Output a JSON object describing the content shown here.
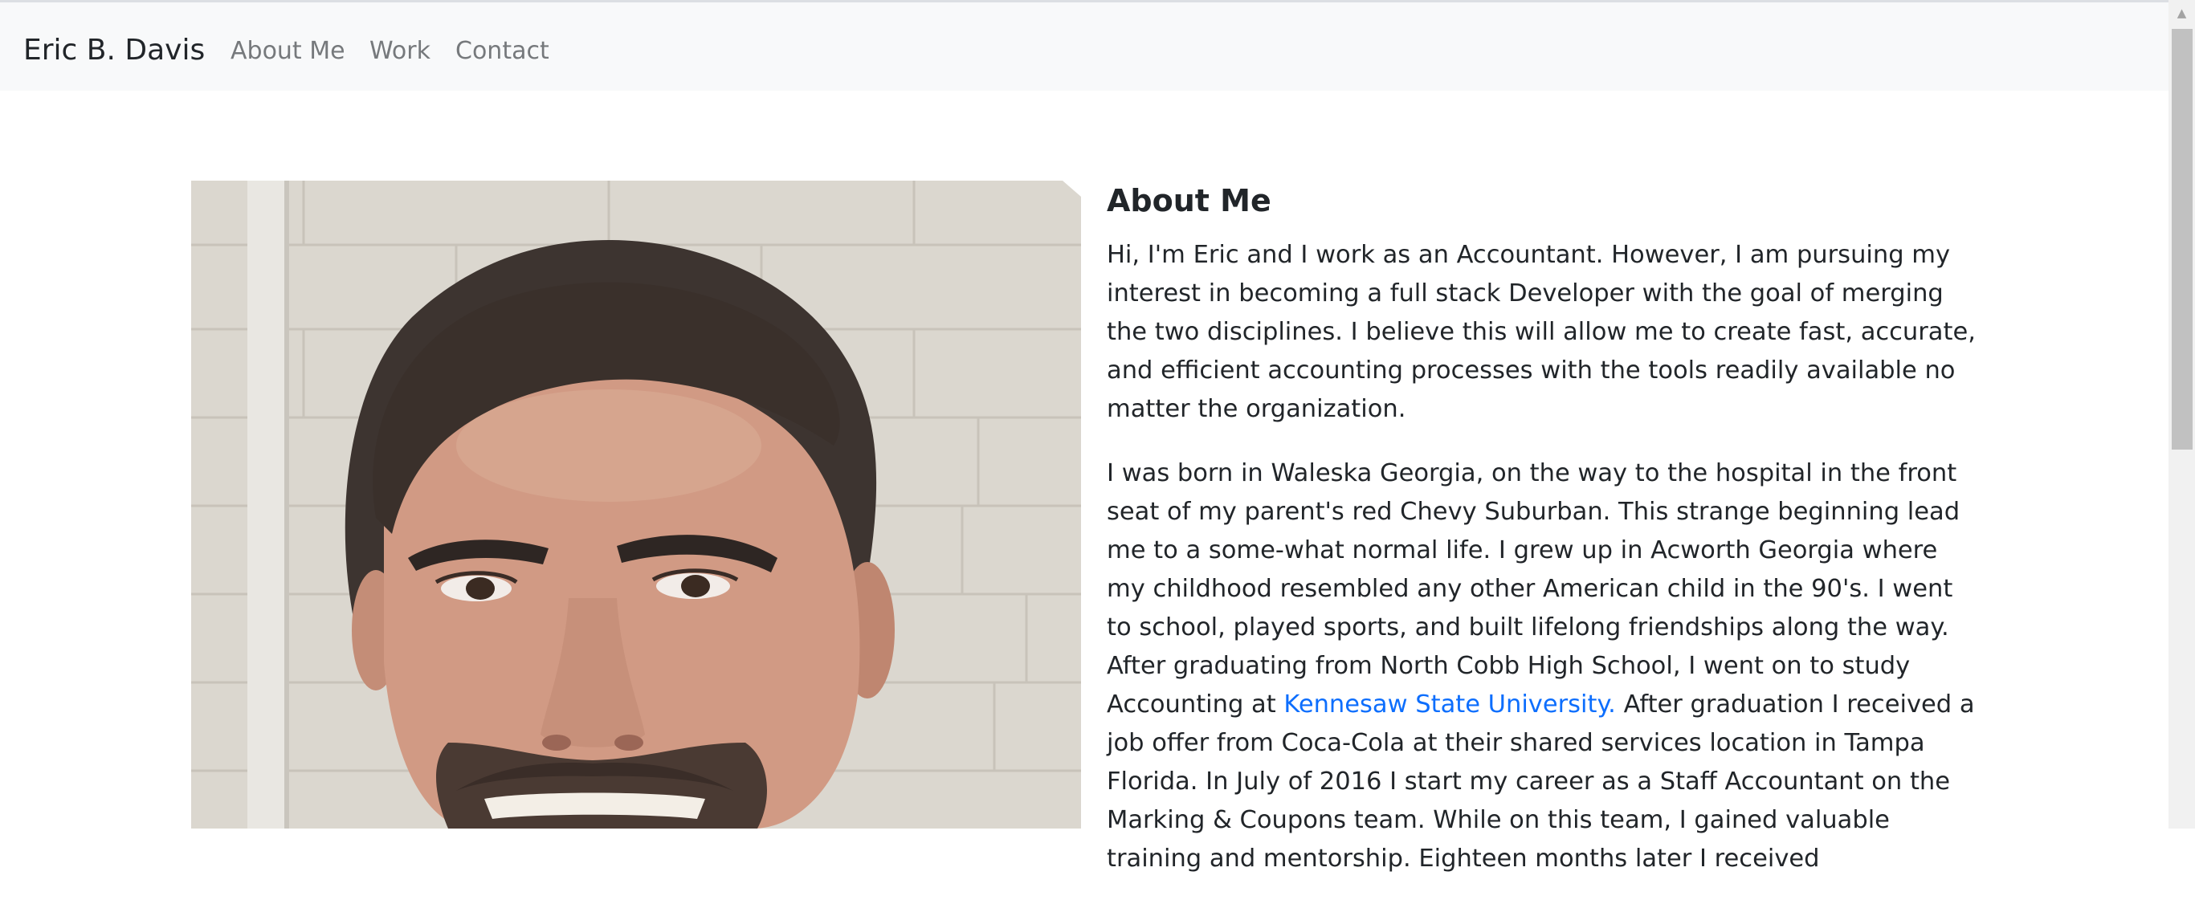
{
  "navbar": {
    "brand": "Eric B. Davis",
    "links": [
      "About Me",
      "Work",
      "Contact"
    ]
  },
  "photo": {
    "subject": "portrait-photo"
  },
  "about": {
    "heading": "About Me",
    "paragraph1": "Hi, I'm Eric and I work as an Accountant. However, I am pursuing my interest in becoming a full stack Developer with the goal of merging the two disciplines. I believe this will allow me to create fast, accurate, and efficient accounting processes with the tools readily available no matter the organization.",
    "paragraph2_before_link": "I was born in Waleska Georgia, on the way to the hospital in the front seat of my parent's red Chevy Suburban. This strange beginning lead me to a some-what normal life. I grew up in Acworth Georgia where my childhood resembled any other American child in the 90's. I went to school, played sports, and built lifelong friendships along the way. After graduating from North Cobb High School, I went on to study Accounting at ",
    "paragraph2_link": "Kennesaw State University.",
    "paragraph2_after_link": " After graduation I received a job offer from Coca-Cola at their shared services location in Tampa Florida. In July of 2016 I start my career as a Staff Accountant on the Marking & Coupons team. While on this team, I gained valuable training and mentorship. Eighteen months later I received"
  },
  "colors": {
    "navbar_bg": "#f8f9fa",
    "link": "#0d6efd",
    "nav_text": "#76797c",
    "text": "#212529"
  },
  "scrollbar": {
    "up_arrow": "▲"
  }
}
